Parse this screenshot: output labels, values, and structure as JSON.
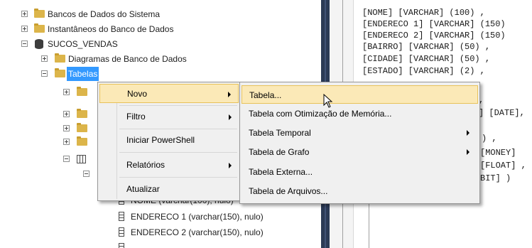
{
  "explorer": {
    "items": [
      {
        "label": "Bancos de Dados do Sistema"
      },
      {
        "label": "Instantâneos do Banco de Dados"
      },
      {
        "label": "SUCOS_VENDAS"
      },
      {
        "label": "Diagramas de Banco de Dados"
      },
      {
        "label": "Tabelas"
      }
    ],
    "columns": [
      {
        "label": "NOME (varchar(100), nulo)"
      },
      {
        "label": "ENDERECO 1 (varchar(150), nulo)"
      },
      {
        "label": "ENDERECO 2 (varchar(150), nulo)"
      }
    ]
  },
  "editor": {
    "lines": [
      "[NOME] [VARCHAR] (100) ,",
      "[ENDERECO 1] [VARCHAR] (150)",
      "[ENDERECO 2] [VARCHAR] (150)",
      "[BAIRRO] [VARCHAR] (50) ,",
      "[CIDADE] [VARCHAR] (50) ,",
      "[ESTADO] [VARCHAR] (2) ,",
      ",",
      "] [DATE],",
      ") ,",
      "[MONEY]",
      "[FLOAT] ,",
      "BIT] )"
    ]
  },
  "context_menu": {
    "items": [
      {
        "label": "Novo"
      },
      {
        "label": "Filtro"
      },
      {
        "label": "Iniciar PowerShell"
      },
      {
        "label": "Relatórios"
      },
      {
        "label": "Atualizar"
      }
    ]
  },
  "submenu": {
    "items": [
      {
        "label": "Tabela..."
      },
      {
        "label": "Tabela com Otimização de Memória..."
      },
      {
        "label": "Tabela Temporal"
      },
      {
        "label": "Tabela de Grafo"
      },
      {
        "label": "Tabela Externa..."
      },
      {
        "label": "Tabela de Arquivos..."
      }
    ]
  },
  "colors": {
    "selection": "#3399ff",
    "menu_hover": "#fbe9b7",
    "folder": "#dcb54a",
    "splitter": "#2b3a55"
  }
}
